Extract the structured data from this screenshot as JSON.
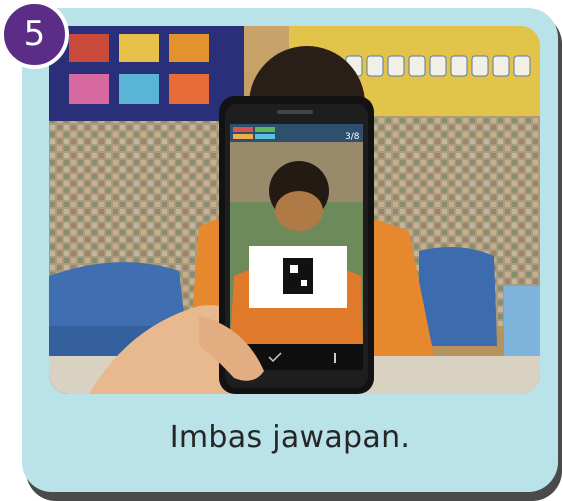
{
  "step": {
    "number": "5"
  },
  "caption": "Imbas jawapan.",
  "phone_screen": {
    "counter": "3/8"
  },
  "colors": {
    "card_background": "#b9e3e8",
    "badge": "#5c2d86",
    "caption_text": "#262626"
  }
}
